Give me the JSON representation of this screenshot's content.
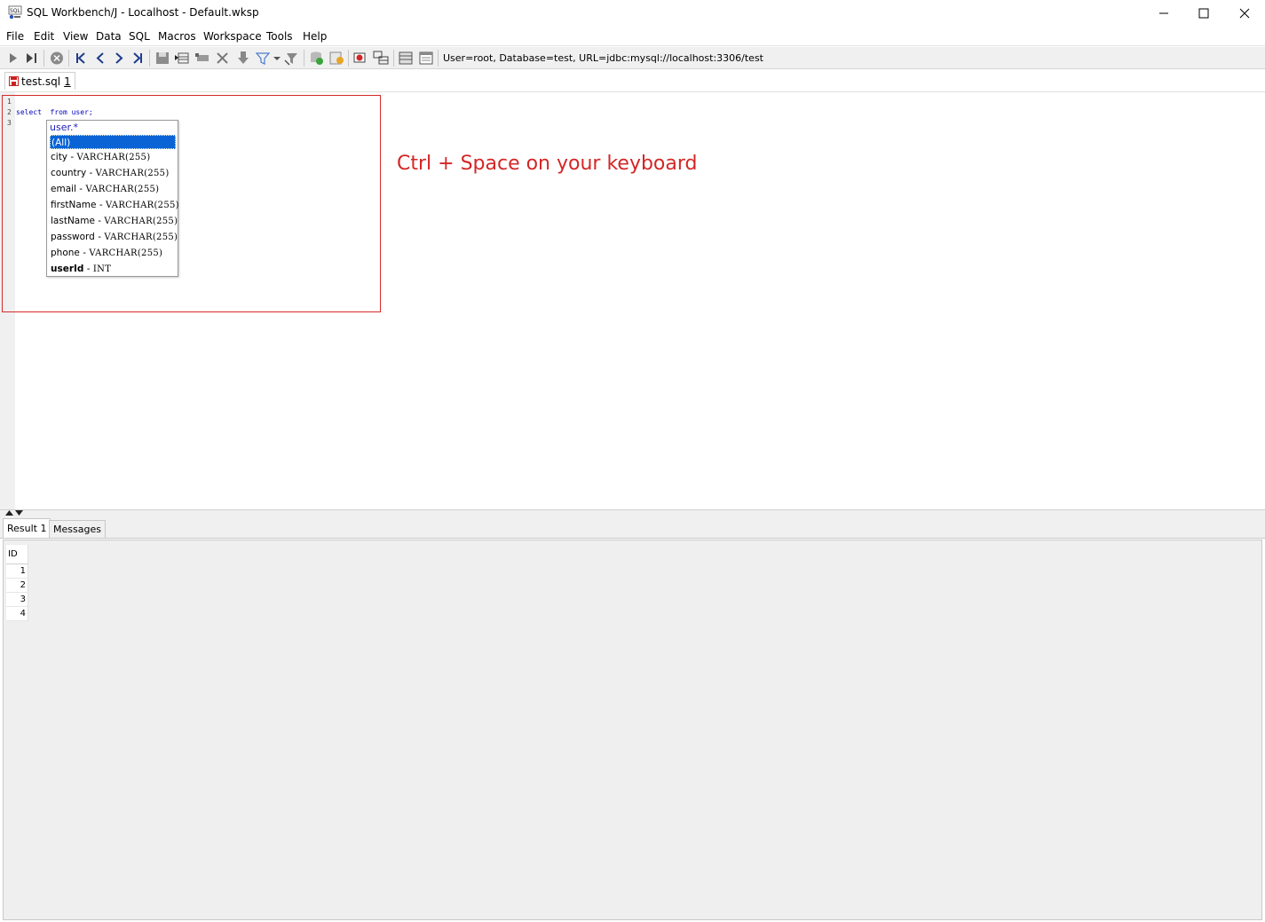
{
  "window": {
    "title": "SQL Workbench/J - Localhost - Default.wksp",
    "app_icon_text": "SQL"
  },
  "menu": [
    "File",
    "Edit",
    "View",
    "Data",
    "SQL",
    "Macros",
    "Workspace",
    "Tools",
    "Help"
  ],
  "toolbar": {
    "connection_info": "User=root, Database=test, URL=jdbc:mysql://localhost:3306/test"
  },
  "editor_tab": {
    "label": "test.sql",
    "number": "1"
  },
  "editor": {
    "line_numbers": [
      "1",
      "2",
      "3"
    ],
    "code": "select  from user;"
  },
  "autocomplete": {
    "header": "user.*",
    "items": [
      {
        "name": "(All)",
        "type": ""
      },
      {
        "name": "city",
        "type": "VARCHAR(255)"
      },
      {
        "name": "country",
        "type": "VARCHAR(255)"
      },
      {
        "name": "email",
        "type": "VARCHAR(255)"
      },
      {
        "name": "firstName",
        "type": "VARCHAR(255)"
      },
      {
        "name": "lastName",
        "type": "VARCHAR(255)"
      },
      {
        "name": "password",
        "type": "VARCHAR(255)"
      },
      {
        "name": "phone",
        "type": "VARCHAR(255)"
      },
      {
        "name": "userId",
        "type": "INT"
      }
    ],
    "separator": " - "
  },
  "annotation": "Ctrl + Space on your keyboard",
  "result_tabs": [
    "Result 1",
    "Messages"
  ],
  "result_grid": {
    "columns": [
      "ID"
    ],
    "rows": [
      "1",
      "2",
      "3",
      "4"
    ]
  },
  "colors": {
    "highlight": "#d62b2b",
    "selection": "#0a64d6",
    "keyword": "#0000c0"
  }
}
